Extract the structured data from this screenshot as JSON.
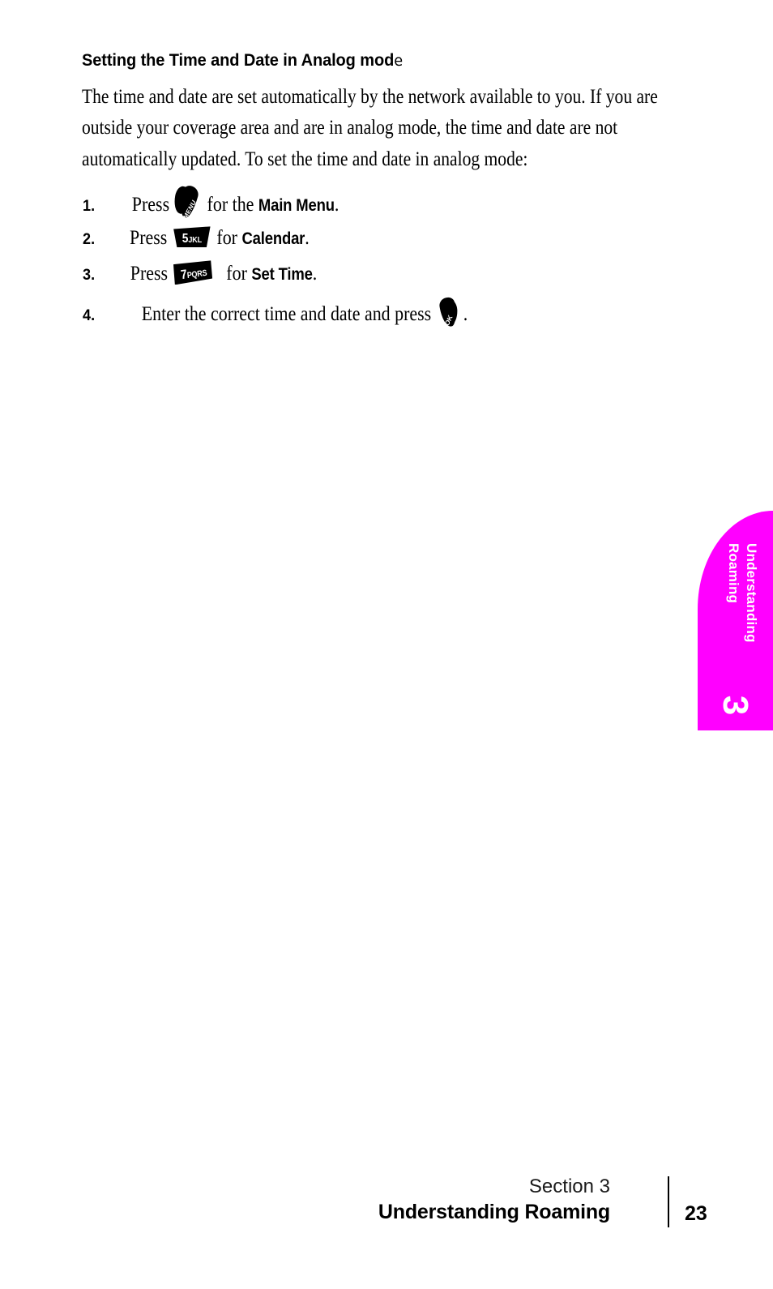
{
  "heading": {
    "main": "Setting the Time and Date in Analog mod",
    "tail": "e"
  },
  "paragraph": "The time and date are set automatically by the network available to you. If you are outside your coverage area and are in analog mode, the time and date are not automatically updated. To set the time and date in analog mode:",
  "steps": [
    {
      "number": "1.",
      "before": "Press",
      "icon": "menu-key-icon",
      "icon_label": "MENU",
      "middle": "for the",
      "bold": "Main Menu",
      "after": "."
    },
    {
      "number": "2.",
      "before": "Press",
      "icon": "key-5-jkl-icon",
      "icon_digit": "5",
      "icon_letters": "JKL",
      "middle": "for",
      "bold": "Calendar",
      "after": "."
    },
    {
      "number": "3.",
      "before": "Press",
      "icon": "key-7-pqrs-icon",
      "icon_digit": "7",
      "icon_letters": "PQRS",
      "middle": "for",
      "bold": "Set Time",
      "after": "."
    },
    {
      "number": "4.",
      "before": "Enter the correct time and date and press",
      "icon": "ok-key-icon",
      "icon_label": "OK",
      "middle": "",
      "bold": "",
      "after": "."
    }
  ],
  "section_tab": {
    "line1": "Understanding",
    "line2": "Roaming",
    "number": "3",
    "color": "#FF00FF"
  },
  "footer": {
    "section": "Section 3",
    "title": "Understanding Roaming",
    "page": "23"
  }
}
